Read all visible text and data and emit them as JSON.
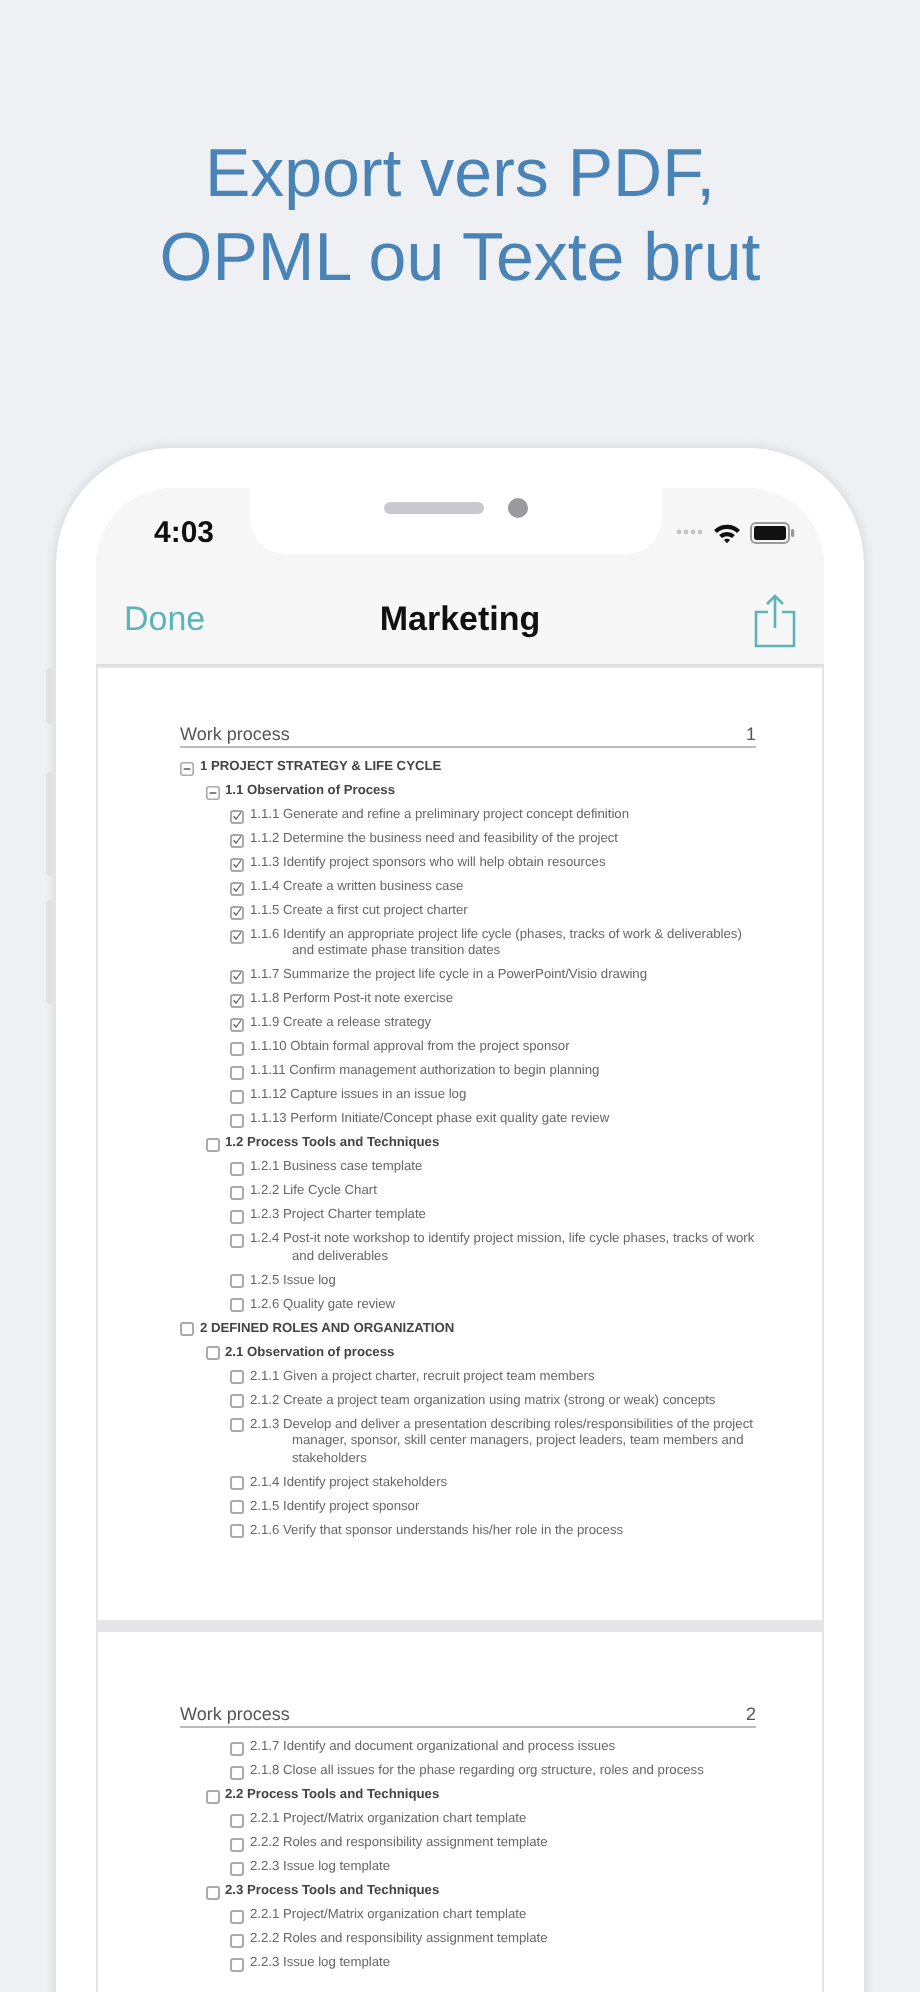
{
  "headline": [
    "Export vers PDF,",
    "OPML ou Texte brut"
  ],
  "status_bar": {
    "time": "4:03"
  },
  "nav": {
    "done": "Done",
    "title": "Marketing"
  },
  "pages": [
    {
      "header": "Work process",
      "number": "1",
      "items": [
        {
          "kind": "toggle",
          "expanded": true,
          "text": "1 PROJECT STRATEGY & LIFE CYCLE",
          "children": [
            {
              "kind": "toggle",
              "expanded": true,
              "text": "1.1 Observation of Process",
              "children": [
                {
                  "kind": "checkbox",
                  "checked": true,
                  "text": "1.1.1 Generate and refine a preliminary project concept definition"
                },
                {
                  "kind": "checkbox",
                  "checked": true,
                  "text": "1.1.2 Determine the business need and feasibility of the project"
                },
                {
                  "kind": "checkbox",
                  "checked": true,
                  "text": "1.1.3 Identify project sponsors who will help obtain resources"
                },
                {
                  "kind": "checkbox",
                  "checked": true,
                  "text": "1.1.4 Create a written business case"
                },
                {
                  "kind": "checkbox",
                  "checked": true,
                  "text": "1.1.5 Create a first cut project charter"
                },
                {
                  "kind": "checkbox",
                  "checked": true,
                  "text": "1.1.6 Identify an appropriate project life cycle (phases, tracks of work & deliverables) and estimate phase transition dates"
                },
                {
                  "kind": "checkbox",
                  "checked": true,
                  "text": "1.1.7 Summarize the project life cycle in a PowerPoint/Visio drawing"
                },
                {
                  "kind": "checkbox",
                  "checked": true,
                  "text": "1.1.8 Perform Post-it note exercise"
                },
                {
                  "kind": "checkbox",
                  "checked": true,
                  "text": "1.1.9 Create a release strategy"
                },
                {
                  "kind": "checkbox",
                  "checked": false,
                  "text": "1.1.10 Obtain formal approval from the project sponsor"
                },
                {
                  "kind": "checkbox",
                  "checked": false,
                  "text": "1.1.11 Confirm management authorization to begin planning"
                },
                {
                  "kind": "checkbox",
                  "checked": false,
                  "text": "1.1.12 Capture issues in an issue log"
                },
                {
                  "kind": "checkbox",
                  "checked": false,
                  "text": "1.1.13 Perform Initiate/Concept phase exit quality gate review"
                }
              ]
            },
            {
              "kind": "checkbox",
              "checked": false,
              "text": "1.2 Process Tools and Techniques",
              "children": [
                {
                  "kind": "checkbox",
                  "checked": false,
                  "text": "1.2.1 Business case template"
                },
                {
                  "kind": "checkbox",
                  "checked": false,
                  "text": "1.2.2 Life Cycle Chart"
                },
                {
                  "kind": "checkbox",
                  "checked": false,
                  "text": "1.2.3 Project Charter template"
                },
                {
                  "kind": "checkbox",
                  "checked": false,
                  "text": "1.2.4 Post-it note workshop to identify project mission, life cycle phases, tracks of work and deliverables"
                },
                {
                  "kind": "checkbox",
                  "checked": false,
                  "text": "1.2.5 Issue log"
                },
                {
                  "kind": "checkbox",
                  "checked": false,
                  "text": "1.2.6 Quality gate review"
                }
              ]
            }
          ]
        },
        {
          "kind": "checkbox",
          "checked": false,
          "text": "2 DEFINED ROLES AND ORGANIZATION",
          "children": [
            {
              "kind": "checkbox",
              "checked": false,
              "text": "2.1 Observation of process",
              "children": [
                {
                  "kind": "checkbox",
                  "checked": false,
                  "text": "2.1.1 Given a project charter, recruit project team members"
                },
                {
                  "kind": "checkbox",
                  "checked": false,
                  "text": "2.1.2 Create a project team organization using matrix (strong or weak) concepts"
                },
                {
                  "kind": "checkbox",
                  "checked": false,
                  "text": "2.1.3 Develop and deliver a presentation describing roles/responsibilities of the project manager, sponsor, skill center managers, project leaders, team members and stakeholders"
                },
                {
                  "kind": "checkbox",
                  "checked": false,
                  "text": "2.1.4 Identify project stakeholders"
                },
                {
                  "kind": "checkbox",
                  "checked": false,
                  "text": "2.1.5 Identify project sponsor"
                },
                {
                  "kind": "checkbox",
                  "checked": false,
                  "text": "2.1.6 Verify that sponsor understands his/her role in the process"
                }
              ]
            }
          ]
        }
      ]
    },
    {
      "header": "Work process",
      "number": "2",
      "items": [
        {
          "kind": "continuation",
          "children": [
            {
              "kind": "continuation",
              "children": [
                {
                  "kind": "checkbox",
                  "checked": false,
                  "text": "2.1.7 Identify and document organizational and process issues"
                },
                {
                  "kind": "checkbox",
                  "checked": false,
                  "text": "2.1.8 Close all issues for the phase regarding org structure, roles and process"
                }
              ]
            },
            {
              "kind": "checkbox",
              "checked": false,
              "text": "2.2 Process Tools and Techniques",
              "children": [
                {
                  "kind": "checkbox",
                  "checked": false,
                  "text": "2.2.1 Project/Matrix organization chart template"
                },
                {
                  "kind": "checkbox",
                  "checked": false,
                  "text": "2.2.2 Roles and responsibility assignment template"
                },
                {
                  "kind": "checkbox",
                  "checked": false,
                  "text": "2.2.3 Issue log template"
                }
              ]
            },
            {
              "kind": "checkbox",
              "checked": false,
              "text": "2.3 Process Tools and Techniques",
              "children": [
                {
                  "kind": "checkbox",
                  "checked": false,
                  "text": "2.2.1 Project/Matrix organization chart template"
                },
                {
                  "kind": "checkbox",
                  "checked": false,
                  "text": "2.2.2 Roles and responsibility assignment template"
                },
                {
                  "kind": "checkbox",
                  "checked": false,
                  "text": "2.2.3 Issue log template"
                }
              ]
            }
          ]
        }
      ]
    }
  ]
}
